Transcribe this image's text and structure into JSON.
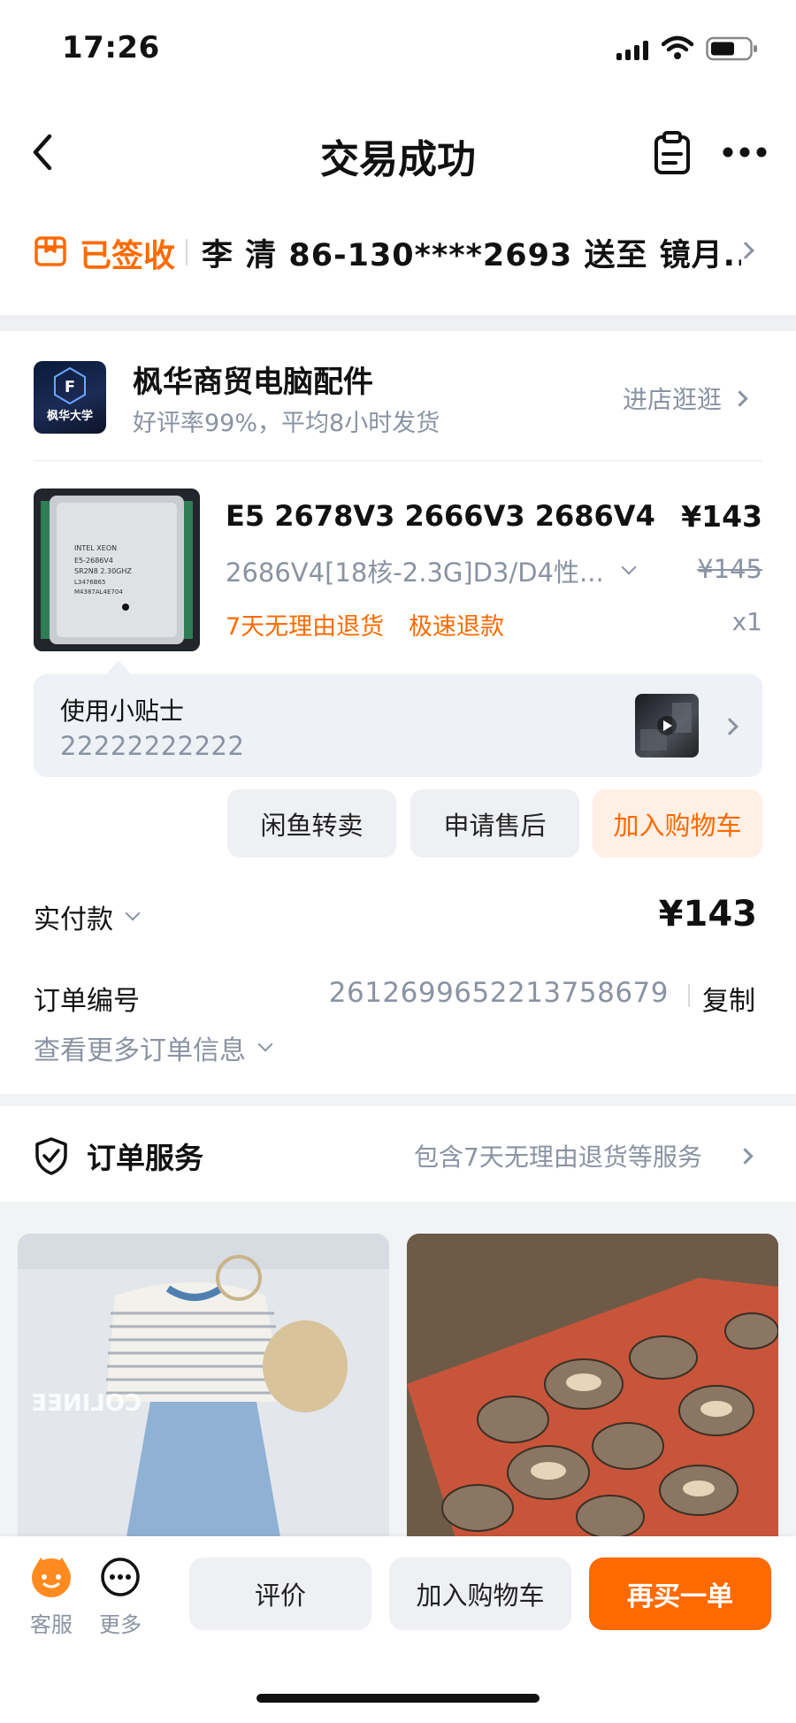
{
  "status_bar": {
    "time": "17:26"
  },
  "header": {
    "title": "交易成功"
  },
  "delivery": {
    "status": "已签收",
    "recipient": "李 清 86-130****2693 送至 镜月..."
  },
  "shop": {
    "name": "枫华商贸电脑配件",
    "logo_text": "枫华大学",
    "logo_letter": "F",
    "rating_text": "好评率99%，平均8小时发货",
    "visit_label": "进店逛逛"
  },
  "product": {
    "title": "E5 2678V3 2666V3 2686V4",
    "spec": "2686V4[18核-2.3G]D3/D4性...",
    "price": "¥143",
    "original_price": "¥145",
    "quantity": "x1",
    "tag1": "7天无理由退货",
    "tag2": "极速退款",
    "cpu_lines": [
      "INTEL XEON",
      "E5-2686V4",
      "SR2N8 2.30GHZ",
      "L3476B65",
      "M4387AL4E704"
    ]
  },
  "tip": {
    "title": "使用小贴士",
    "value": "22222222222"
  },
  "actions": {
    "resell": "闲鱼转卖",
    "after_sale": "申请售后",
    "add_cart": "加入购物车"
  },
  "payment": {
    "label": "实付款",
    "amount": "¥143"
  },
  "order": {
    "number_label": "订单编号",
    "number": "2612699652213758679",
    "copy_label": "复制",
    "more_label": "查看更多订单信息"
  },
  "service": {
    "label": "订单服务",
    "desc": "包含7天无理由退货等服务"
  },
  "recommend": {
    "item1_watermark": "COLINEE"
  },
  "bottom_bar": {
    "service_label": "客服",
    "more_label": "更多",
    "review": "评价",
    "add_cart": "加入购物车",
    "buy_again": "再买一单"
  },
  "colors": {
    "accent": "#ff6a00",
    "accent_light": "#fff0e6",
    "gray_text": "#8a93a3",
    "button_bg": "#eef0f3"
  }
}
